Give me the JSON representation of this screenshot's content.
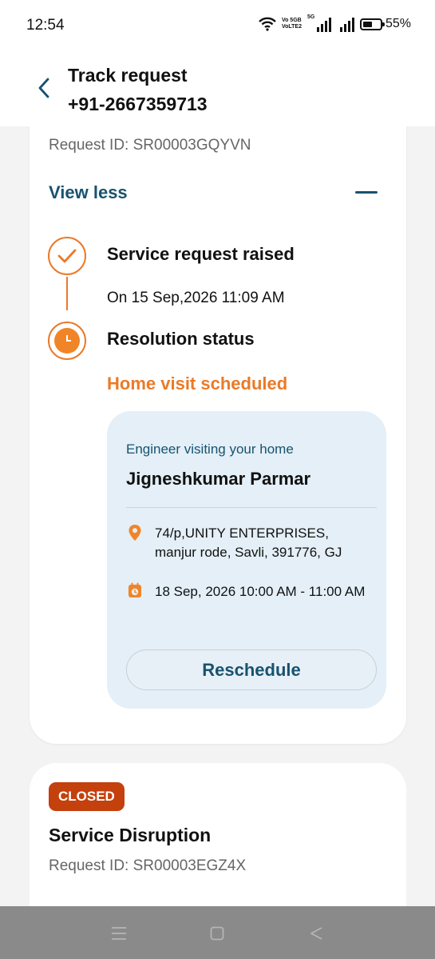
{
  "status_bar": {
    "time": "12:54",
    "volte_line1": "Vo 5GB",
    "volte_line2": "VoLTE2",
    "network_tag": "5G",
    "battery_percent": "55%",
    "battery_level": 0.55
  },
  "header": {
    "title": "Track request",
    "subtitle": "+91-2667359713"
  },
  "request_card": {
    "request_id": "Request ID: SR00003GQYVN",
    "toggle_label": "View less",
    "steps": [
      {
        "title": "Service request raised",
        "detail": "On 15 Sep,2026 11:09 AM",
        "state": "done"
      },
      {
        "title": "Resolution status",
        "detail": "Home visit scheduled",
        "state": "in-progress"
      }
    ],
    "engineer": {
      "label": "Engineer visiting your home",
      "name": "Jigneshkumar Parmar",
      "address": "74/p,UNITY ENTERPRISES, manjur rode, Savli, 391776, GJ",
      "schedule": "18 Sep, 2026 10:00 AM - 11:00 AM",
      "reschedule_label": "Reschedule"
    }
  },
  "second_card": {
    "badge": "CLOSED",
    "title": "Service Disruption",
    "request_id": "Request ID: SR00003EGZ4X"
  },
  "colors": {
    "brand_blue": "#17536f",
    "accent_orange": "#ea7a27",
    "closed_red": "#c4400d",
    "panel_bg": "#e4eff7"
  },
  "icons": {
    "back": "chevron-left-icon",
    "done": "check-icon",
    "pending": "clock-icon",
    "address": "location-pin-icon",
    "schedule": "calendar-icon"
  }
}
